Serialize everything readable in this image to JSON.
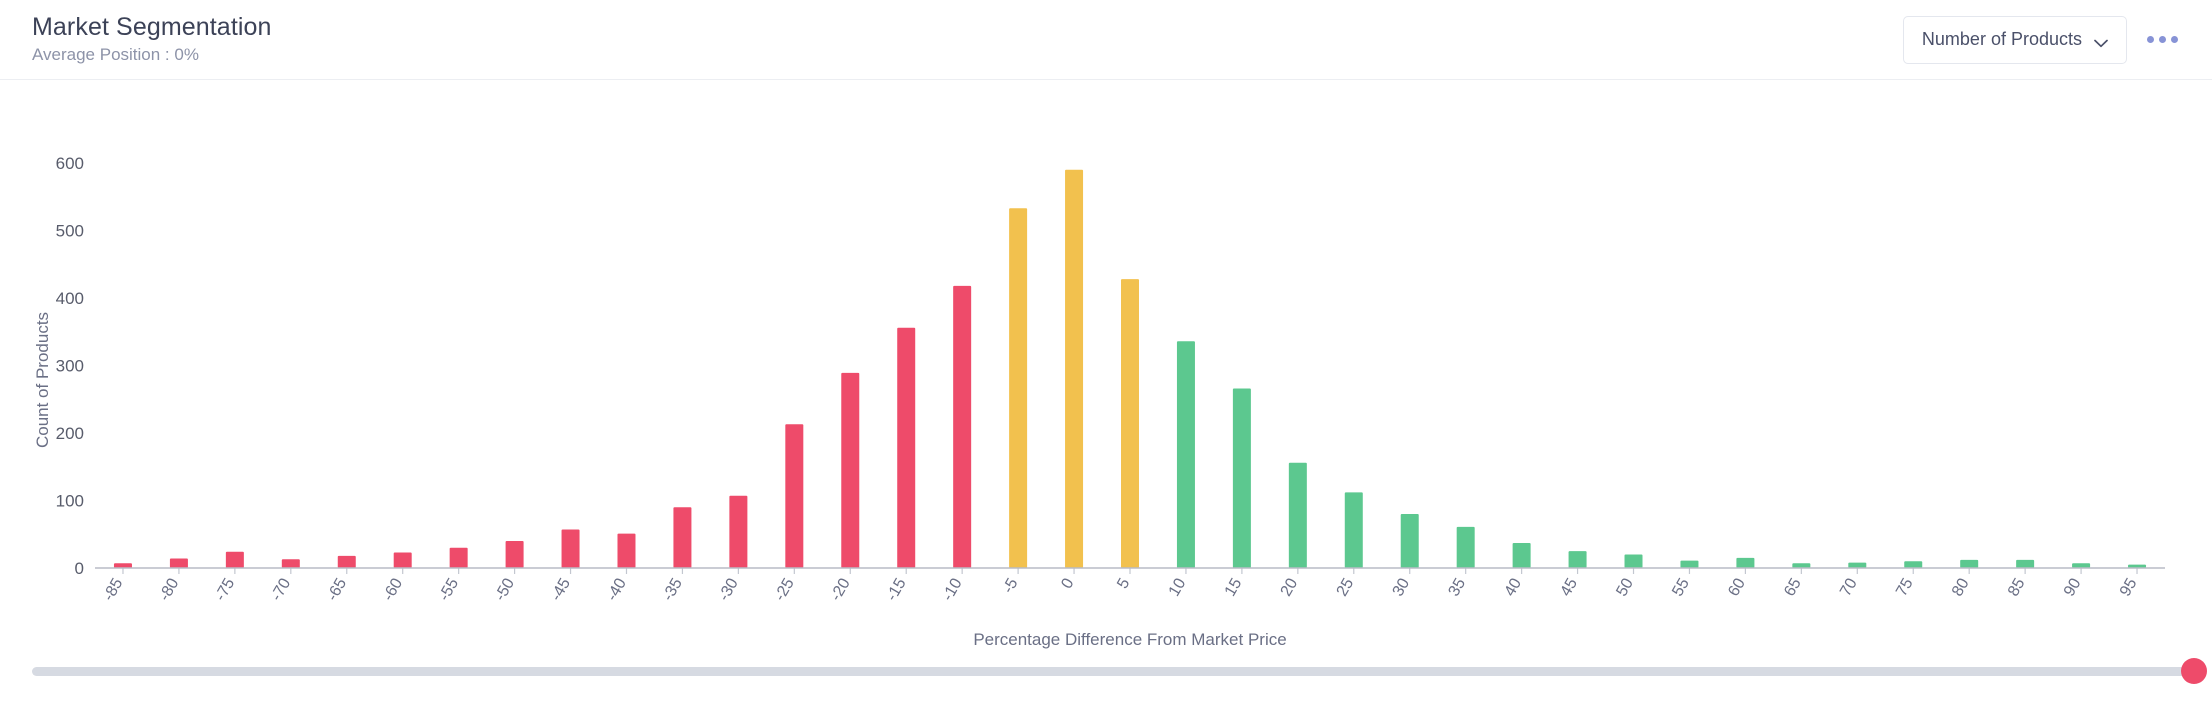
{
  "header": {
    "title": "Market Segmentation",
    "subtitle": "Average Position : 0%",
    "metric_select_label": "Number of Products",
    "chevron_icon": "chevron-down-icon",
    "menu_icon": "more-options-icon"
  },
  "slider": {
    "position_percent": 100,
    "thumb_color": "#ee4b6a",
    "track_color": "#d6dae2"
  },
  "colors": {
    "below_market": "#ee4b6a",
    "at_market": "#f2c14e",
    "above_market": "#5cc88f",
    "axis": "#b8bcc6",
    "text": "#6a6f85"
  },
  "chart_data": {
    "type": "bar",
    "title": "Market Segmentation",
    "subtitle": "Average Position : 0%",
    "xlabel": "Percentage Difference From Market Price",
    "ylabel": "Count of Products",
    "ylim": [
      0,
      600
    ],
    "yticks": [
      0,
      100,
      200,
      300,
      400,
      500,
      600
    ],
    "grid": false,
    "legend": "none",
    "categories": [
      "-85",
      "-80",
      "-75",
      "-70",
      "-65",
      "-60",
      "-55",
      "-50",
      "-45",
      "-40",
      "-35",
      "-30",
      "-25",
      "-20",
      "-15",
      "-10",
      "-5",
      "0",
      "5",
      "10",
      "15",
      "20",
      "25",
      "30",
      "35",
      "40",
      "45",
      "50",
      "55",
      "60",
      "65",
      "70",
      "75",
      "80",
      "85",
      "90",
      "95"
    ],
    "values": [
      7,
      14,
      24,
      13,
      18,
      23,
      30,
      40,
      57,
      51,
      90,
      107,
      213,
      289,
      356,
      418,
      533,
      590,
      428,
      336,
      266,
      156,
      112,
      80,
      61,
      37,
      25,
      20,
      11,
      15,
      7,
      8,
      10,
      12,
      12,
      7,
      5
    ],
    "bar_colors": [
      "#ee4b6a",
      "#ee4b6a",
      "#ee4b6a",
      "#ee4b6a",
      "#ee4b6a",
      "#ee4b6a",
      "#ee4b6a",
      "#ee4b6a",
      "#ee4b6a",
      "#ee4b6a",
      "#ee4b6a",
      "#ee4b6a",
      "#ee4b6a",
      "#ee4b6a",
      "#ee4b6a",
      "#ee4b6a",
      "#f2c14e",
      "#f2c14e",
      "#f2c14e",
      "#5cc88f",
      "#5cc88f",
      "#5cc88f",
      "#5cc88f",
      "#5cc88f",
      "#5cc88f",
      "#5cc88f",
      "#5cc88f",
      "#5cc88f",
      "#5cc88f",
      "#5cc88f",
      "#5cc88f",
      "#5cc88f",
      "#5cc88f",
      "#5cc88f",
      "#5cc88f",
      "#5cc88f",
      "#5cc88f"
    ]
  }
}
